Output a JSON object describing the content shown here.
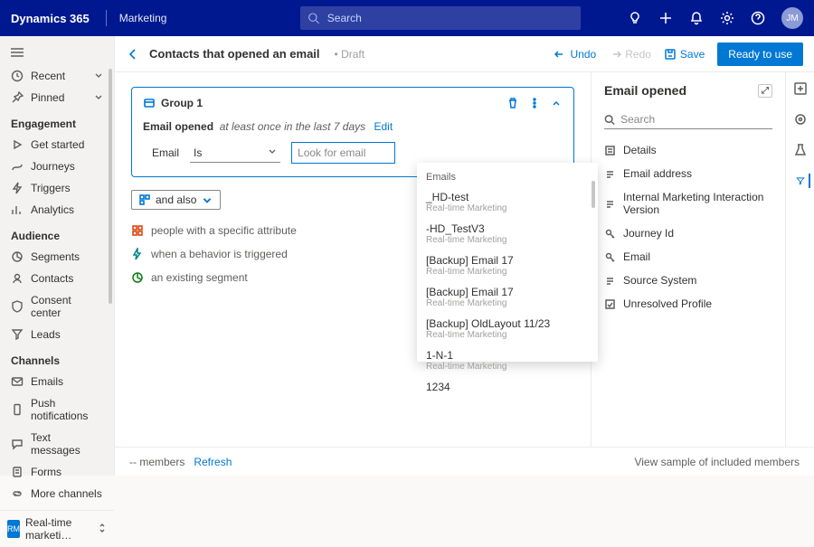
{
  "brand": {
    "product": "Dynamics 365",
    "app": "Marketing"
  },
  "search": {
    "placeholder": "Search"
  },
  "topbar": {
    "avatar_initials": "JM"
  },
  "nav": {
    "recent": "Recent",
    "pinned": "Pinned",
    "sections": {
      "engagement": "Engagement",
      "audience": "Audience",
      "channels": "Channels"
    },
    "items": {
      "get_started": "Get started",
      "journeys": "Journeys",
      "triggers": "Triggers",
      "analytics": "Analytics",
      "segments": "Segments",
      "contacts": "Contacts",
      "consent_center": "Consent center",
      "leads": "Leads",
      "emails": "Emails",
      "push": "Push notifications",
      "text": "Text messages",
      "forms": "Forms",
      "more_channels": "More channels"
    },
    "switcher": {
      "badge": "RM",
      "label": "Real-time marketi…"
    }
  },
  "cmdbar": {
    "title": "Contacts that opened an email",
    "status": "Draft",
    "undo": "Undo",
    "redo": "Redo",
    "save": "Save",
    "primary": "Ready to use"
  },
  "group": {
    "title": "Group 1",
    "cond_label": "Email opened",
    "cond_desc": "at least once in the last 7 days",
    "edit": "Edit",
    "row_label": "Email",
    "operator": "Is",
    "placeholder": "Look for email"
  },
  "and_also": "and also",
  "add_options": {
    "attribute": "people with a specific attribute",
    "behavior": "when a behavior is triggered",
    "segment": "an existing segment"
  },
  "dropdown": {
    "header": "Emails",
    "sub": "Real-time Marketing",
    "items": [
      {
        "label": "_HD-test"
      },
      {
        "label": "-HD_TestV3"
      },
      {
        "label": "[Backup] Email 17"
      },
      {
        "label": "[Backup] Email 17"
      },
      {
        "label": "[Backup] OldLayout 11/23"
      },
      {
        "label": "1-N-1"
      },
      {
        "label": "1234"
      }
    ]
  },
  "panel": {
    "title": "Email opened",
    "search_placeholder": "Search",
    "attributes": {
      "details": "Details",
      "email_address": "Email address",
      "interaction_version": "Internal Marketing Interaction Version",
      "journey_id": "Journey Id",
      "email": "Email",
      "source_system": "Source System",
      "unresolved_profile": "Unresolved Profile"
    }
  },
  "footer": {
    "members": "-- members",
    "refresh": "Refresh",
    "sample": "View sample of included members"
  }
}
